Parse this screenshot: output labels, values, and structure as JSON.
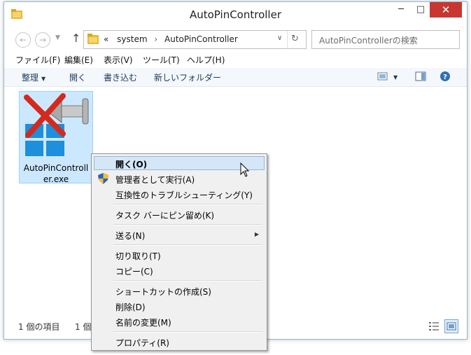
{
  "window": {
    "title": "AutoPinController",
    "controls": {
      "minimize": "─",
      "maximize": "□",
      "close": "✕"
    }
  },
  "address": {
    "path_prefix": "«",
    "crumbs": [
      "system",
      "AutoPinController"
    ],
    "separator": "›",
    "search_placeholder": "AutoPinControllerの検索"
  },
  "menubar": [
    "ファイル(F)",
    "編集(E)",
    "表示(V)",
    "ツール(T)",
    "ヘルプ(H)"
  ],
  "toolbar": {
    "organize": "整理",
    "open": "開く",
    "burn": "書き込む",
    "new_folder": "新しいフォルダー"
  },
  "file": {
    "name_line1": "AutoPinControll",
    "name_line2": "er.exe"
  },
  "status": {
    "count": "1 個の項目",
    "selected": "1 個"
  },
  "context_menu": {
    "open": "開く(O)",
    "run_as_admin": "管理者として実行(A)",
    "troubleshoot": "互換性のトラブルシューティング(Y)",
    "pin_taskbar": "タスク バーにピン留め(K)",
    "send_to": "送る(N)",
    "cut": "切り取り(T)",
    "copy": "コピー(C)",
    "create_shortcut": "ショートカットの作成(S)",
    "delete": "削除(D)",
    "rename": "名前の変更(M)",
    "properties": "プロパティ(R)"
  },
  "colors": {
    "accent": "#cce8ff",
    "close_red": "#c7372f",
    "menu_highlight": "#d5e6f7"
  }
}
